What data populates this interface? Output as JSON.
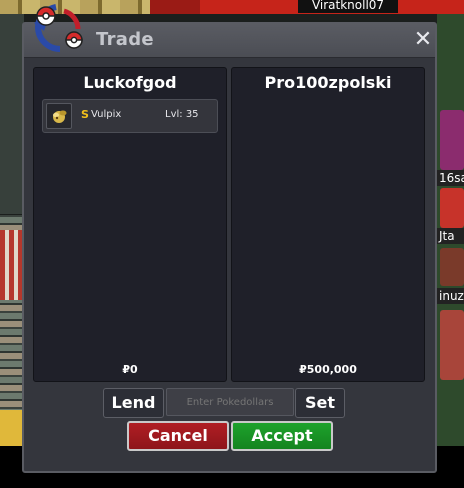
{
  "world": {
    "top_player_name": "Viratknoll07",
    "side_labels": [
      "16sa",
      "Jta",
      "inuz"
    ]
  },
  "window": {
    "title": "Trade",
    "close_glyph": "✕"
  },
  "left_party": {
    "name": "Luckofgod",
    "items": [
      {
        "icon": "bug-pokemon-icon",
        "shiny_mark": "S",
        "name": "Vulpix",
        "level": "Lvl: 35"
      }
    ],
    "money": "₽0"
  },
  "right_party": {
    "name": "Pro100zpolski",
    "items": [],
    "money": "₽500,000"
  },
  "controls": {
    "lend_label": "Lend",
    "money_placeholder": "Enter Pokedollars",
    "set_label": "Set",
    "cancel_label": "Cancel",
    "accept_label": "Accept"
  },
  "colors": {
    "cancel": "#a01a20",
    "accept": "#1a9a28",
    "shiny": "#f2c01b"
  }
}
